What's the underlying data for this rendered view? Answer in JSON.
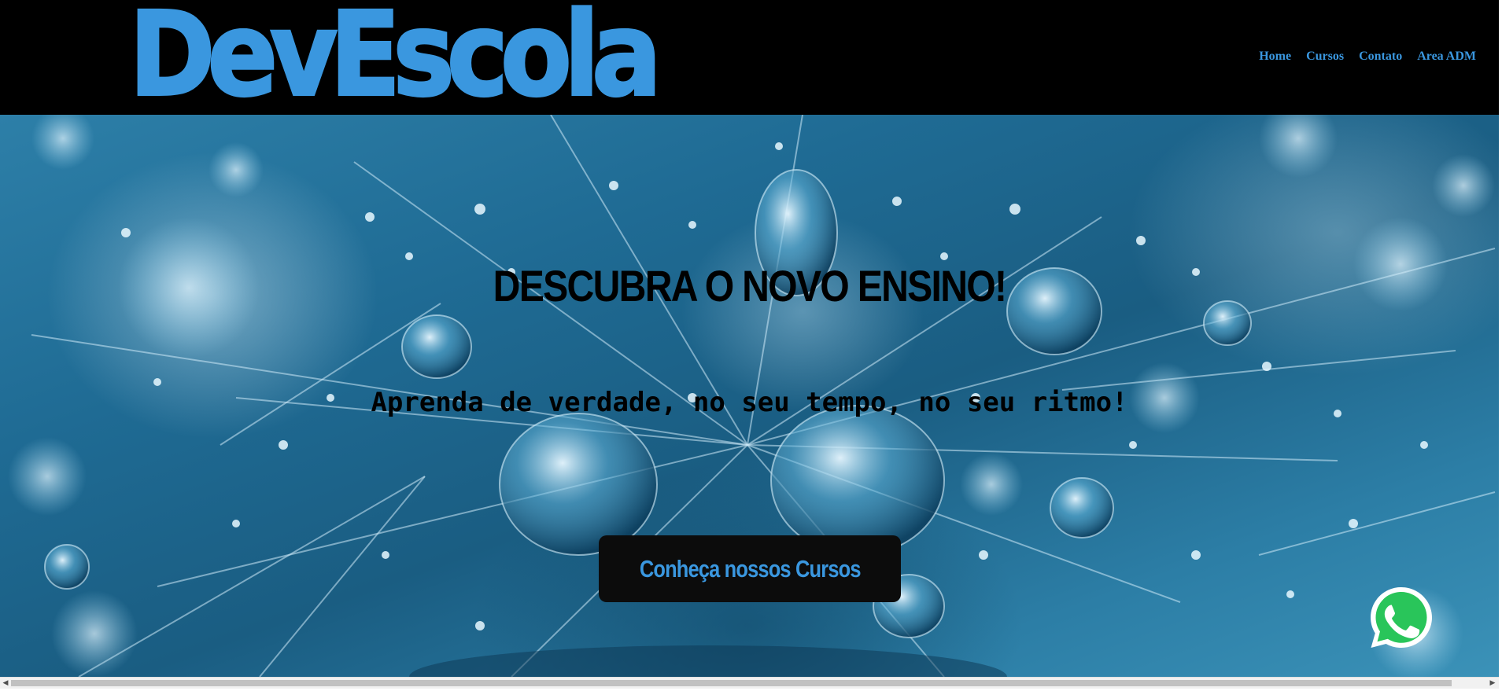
{
  "site": {
    "logo_text": "DevEscola",
    "brand_color": "#3a97df"
  },
  "nav": {
    "items": [
      {
        "label": "Home"
      },
      {
        "label": "Cursos"
      },
      {
        "label": "Contato"
      },
      {
        "label": "Area ADM"
      }
    ]
  },
  "hero": {
    "title": "DESCUBRA O NOVO ENSINO!",
    "subtitle": "Aprenda de verdade, no seu tempo, no seu ritmo!",
    "cta_label": "Conheça nossos Cursos",
    "background": "water-droplets-on-dandelion-photo"
  },
  "floating": {
    "whatsapp_icon": "whatsapp-icon",
    "whatsapp_color": "#25d366"
  },
  "scrollbar": {
    "orientation": "horizontal"
  }
}
